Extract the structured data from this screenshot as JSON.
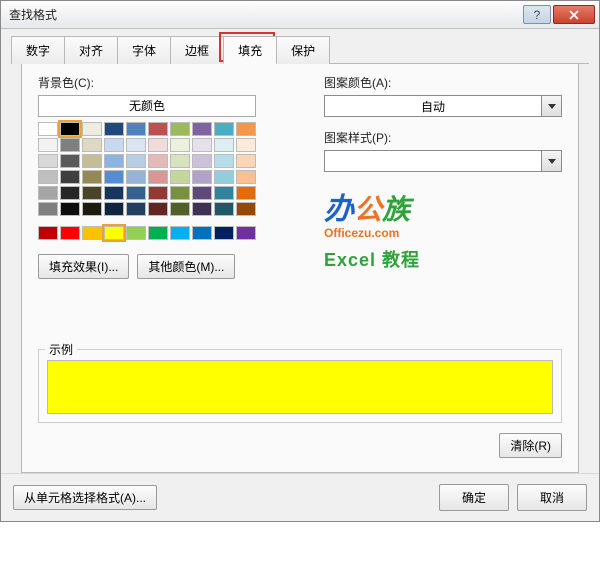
{
  "title": "查找格式",
  "tabs": [
    "数字",
    "对齐",
    "字体",
    "边框",
    "填充",
    "保护"
  ],
  "activeTab": 4,
  "labels": {
    "bgColor": "背景色(C):",
    "noColor": "无颜色",
    "patternColor": "图案颜色(A):",
    "auto": "自动",
    "patternStyle": "图案样式(P):",
    "fillEffects": "填充效果(I)...",
    "otherColors": "其他颜色(M)...",
    "example": "示例",
    "clear": "清除(R)",
    "fromCell": "从单元格选择格式(A)...",
    "ok": "确定",
    "cancel": "取消"
  },
  "watermark": {
    "ban": "办",
    "gong": "公",
    "zu": "族",
    "url": "Officezu.com",
    "excel": "Excel 教程"
  },
  "palette": {
    "themeRows": [
      [
        "#ffffff",
        "#000000",
        "#eeece1",
        "#1f497d",
        "#4f81bd",
        "#c0504d",
        "#9bbb59",
        "#8064a2",
        "#4bacc6",
        "#f79646"
      ],
      [
        "#f2f2f2",
        "#7f7f7f",
        "#ddd9c3",
        "#c6d9f0",
        "#dbe5f1",
        "#f2dcdb",
        "#ebf1dd",
        "#e5e0ec",
        "#dbeef3",
        "#fdeada"
      ],
      [
        "#d8d8d8",
        "#595959",
        "#c4bd97",
        "#8db3e2",
        "#b8cce4",
        "#e5b9b7",
        "#d7e3bc",
        "#ccc1d9",
        "#b7dde8",
        "#fbd5b5"
      ],
      [
        "#bfbfbf",
        "#3f3f3f",
        "#938953",
        "#548dd4",
        "#95b3d7",
        "#d99694",
        "#c3d69b",
        "#b2a2c7",
        "#92cddc",
        "#fac08f"
      ],
      [
        "#a5a5a5",
        "#262626",
        "#494429",
        "#17365d",
        "#366092",
        "#953734",
        "#76923c",
        "#5f497a",
        "#31859b",
        "#e36c09"
      ],
      [
        "#7f7f7f",
        "#0c0c0c",
        "#1d1b10",
        "#0f243e",
        "#244061",
        "#632423",
        "#4f6128",
        "#3f3151",
        "#205867",
        "#974806"
      ]
    ],
    "standardRow": [
      "#c00000",
      "#ff0000",
      "#ffc000",
      "#ffff00",
      "#92d050",
      "#00b050",
      "#00b0f0",
      "#0070c0",
      "#002060",
      "#7030a0"
    ],
    "selectedTheme": [
      0,
      1
    ],
    "selectedStandard": 3
  },
  "exampleColor": "#ffff00"
}
